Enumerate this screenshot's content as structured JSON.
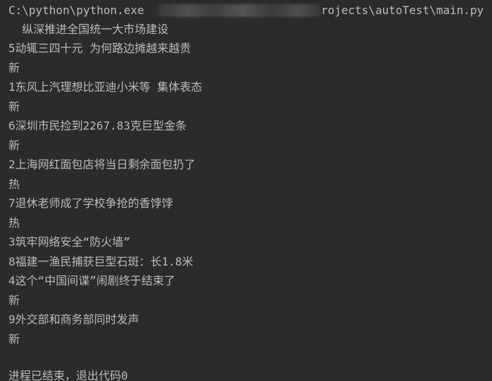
{
  "console": {
    "command": {
      "prefix": "C:\\python\\python.exe",
      "suffix": "rojects\\autoTest\\main.py"
    },
    "lines": [
      "  纵深推进全国统一大市场建设",
      "5动辄三四十元 为何路边摊越来越贵",
      "新",
      "1东风上汽理想比亚迪小米等 集体表态",
      "新",
      "6深圳市民捡到2267.83克巨型金条",
      "新",
      "2上海网红面包店将当日剩余面包扔了",
      "热",
      "7退休老师成了学校争抢的香饽饽",
      "热",
      "3筑牢网络安全“防火墙”",
      "8福建一渔民捕获巨型石斑：长1.8米",
      "4这个“中国间谍”闹剧终于结束了",
      "新",
      "9外交部和商务部同时发声",
      "新"
    ],
    "exit_message": "进程已结束，退出代码0"
  }
}
